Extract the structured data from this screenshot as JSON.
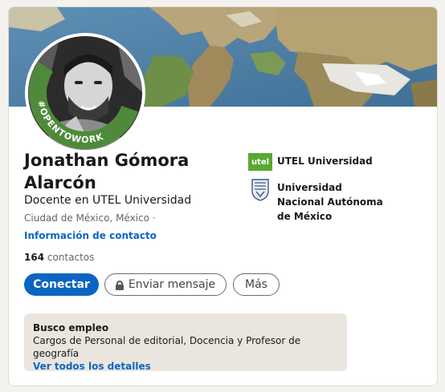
{
  "profile": {
    "name": "Jonathan Gómora Alarcón",
    "headline": "Docente en UTEL Universidad",
    "location": "Ciudad de México, México ·",
    "contact_link": "Información de contacto",
    "connections_count": "164",
    "connections_label": " contactos",
    "avatar_badge_text": "#OPENTOWORK"
  },
  "actions": {
    "connect_label": "Conectar",
    "message_label": "Enviar mensaje",
    "more_label": "Más"
  },
  "organizations": [
    {
      "name": "UTEL Universidad",
      "logo_text": "utel",
      "logo_color": "#5aa832"
    },
    {
      "name": "Universidad Nacional Autónoma de México",
      "logo_icon": "unam-crest-icon"
    }
  ],
  "open_to_work": {
    "title": "Busco empleo",
    "roles": "Cargos de Personal de editorial, Docencia y Profesor de geografía",
    "link": "Ver todos los detalles"
  },
  "colors": {
    "primary": "#0a66c2",
    "open_to_work_green": "#4f8a3a",
    "card_bg": "#ffffff",
    "page_bg": "#f4f2ee"
  }
}
